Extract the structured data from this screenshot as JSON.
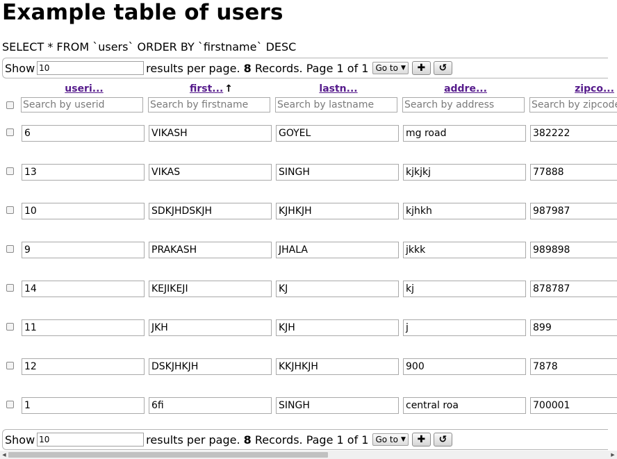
{
  "page": {
    "title": "Example table of users",
    "query": "SELECT * FROM `users` ORDER BY `firstname` DESC"
  },
  "pager": {
    "show_label": "Show",
    "per_page_value": "10",
    "per_page_suffix": "results per page.",
    "record_count": "8",
    "records_text": "Records. Page 1 of 1",
    "goto_label": "Go to",
    "add_icon": "plus-icon",
    "refresh_icon": "refresh-icon"
  },
  "columns": [
    {
      "key": "userid",
      "label": "useri...",
      "placeholder": "Search by userid"
    },
    {
      "key": "firstname",
      "label": "first...",
      "placeholder": "Search by firstname",
      "sort": "↑"
    },
    {
      "key": "lastname",
      "label": "lastn...",
      "placeholder": "Search by lastname"
    },
    {
      "key": "address",
      "label": "addre...",
      "placeholder": "Search by address"
    },
    {
      "key": "zipcode",
      "label": "zipco...",
      "placeholder": "Search by zipcode"
    }
  ],
  "rows": [
    [
      "6",
      "VIKASH",
      "GOYEL",
      "mg road",
      "382222"
    ],
    [
      "13",
      "VIKAS",
      "SINGH",
      "kjkjkj",
      "77888"
    ],
    [
      "10",
      "SDKJHDSKJH",
      "KJHKJH",
      "kjhkh",
      "987987"
    ],
    [
      "9",
      "PRAKASH",
      "JHALA",
      "jkkk",
      "989898"
    ],
    [
      "14",
      "KEJIKEJI",
      "KJ",
      "kj",
      "878787"
    ],
    [
      "11",
      "JKH",
      "KJH",
      "j",
      "899"
    ],
    [
      "12",
      "DSKJHKJH",
      "KKJHKJH",
      "900",
      "7878"
    ],
    [
      "1",
      "6fi",
      "SINGH",
      "central roa",
      "700001"
    ]
  ],
  "colors": {
    "header_link": "#551a8b"
  }
}
